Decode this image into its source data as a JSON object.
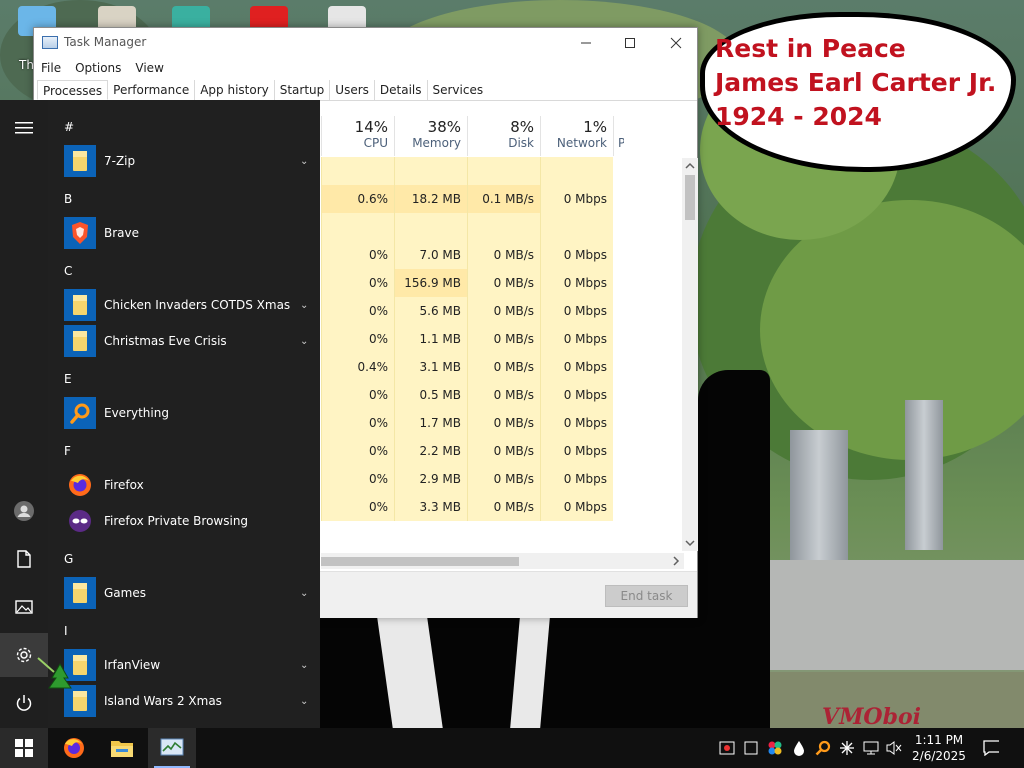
{
  "desktop": {
    "speech_lines": [
      "Rest in Peace",
      "James Earl Carter Jr.",
      "1924 - 2024"
    ],
    "watermark": "VMOboi",
    "recycle_label_fragment": "Th"
  },
  "task_manager": {
    "title": "Task Manager",
    "menu": [
      "File",
      "Options",
      "View"
    ],
    "tabs": [
      "Processes",
      "Performance",
      "App history",
      "Startup",
      "Users",
      "Details",
      "Services"
    ],
    "active_tab": "Processes",
    "columns": [
      {
        "percent": "14%",
        "label": "CPU"
      },
      {
        "percent": "38%",
        "label": "Memory"
      },
      {
        "percent": "8%",
        "label": "Disk"
      },
      {
        "percent": "1%",
        "label": "Network"
      },
      {
        "percent": "",
        "label": "P"
      }
    ],
    "rows": [
      {
        "cpu": "",
        "memory": "",
        "disk": "",
        "network": ""
      },
      {
        "cpu": "0.6%",
        "memory": "18.2 MB",
        "disk": "0.1 MB/s",
        "network": "0 Mbps"
      },
      {
        "cpu": "",
        "memory": "",
        "disk": "",
        "network": ""
      },
      {
        "cpu": "0%",
        "memory": "7.0 MB",
        "disk": "0 MB/s",
        "network": "0 Mbps"
      },
      {
        "cpu": "0%",
        "memory": "156.9 MB",
        "disk": "0 MB/s",
        "network": "0 Mbps"
      },
      {
        "cpu": "0%",
        "memory": "5.6 MB",
        "disk": "0 MB/s",
        "network": "0 Mbps"
      },
      {
        "cpu": "0%",
        "memory": "1.1 MB",
        "disk": "0 MB/s",
        "network": "0 Mbps"
      },
      {
        "cpu": "0.4%",
        "memory": "3.1 MB",
        "disk": "0 MB/s",
        "network": "0 Mbps"
      },
      {
        "cpu": "0%",
        "memory": "0.5 MB",
        "disk": "0 MB/s",
        "network": "0 Mbps"
      },
      {
        "cpu": "0%",
        "memory": "1.7 MB",
        "disk": "0 MB/s",
        "network": "0 Mbps"
      },
      {
        "cpu": "0%",
        "memory": "2.2 MB",
        "disk": "0 MB/s",
        "network": "0 Mbps"
      },
      {
        "cpu": "0%",
        "memory": "2.9 MB",
        "disk": "0 MB/s",
        "network": "0 Mbps"
      },
      {
        "cpu": "0%",
        "memory": "3.3 MB",
        "disk": "0 MB/s",
        "network": "0 Mbps"
      }
    ],
    "end_task_label": "End task"
  },
  "start_menu": {
    "groups": [
      {
        "letter": "#",
        "apps": [
          {
            "name": "7-Zip",
            "icon": "folder",
            "expandable": true
          }
        ]
      },
      {
        "letter": "B",
        "apps": [
          {
            "name": "Brave",
            "icon": "brave",
            "expandable": false
          }
        ]
      },
      {
        "letter": "C",
        "apps": [
          {
            "name": "Chicken Invaders COTDS Xmas",
            "icon": "folder",
            "expandable": true
          },
          {
            "name": "Christmas Eve Crisis",
            "icon": "folder",
            "expandable": true
          }
        ]
      },
      {
        "letter": "E",
        "apps": [
          {
            "name": "Everything",
            "icon": "everything",
            "expandable": false
          }
        ]
      },
      {
        "letter": "F",
        "apps": [
          {
            "name": "Firefox",
            "icon": "firefox",
            "expandable": false
          },
          {
            "name": "Firefox Private Browsing",
            "icon": "firefox-private",
            "expandable": false
          }
        ]
      },
      {
        "letter": "G",
        "apps": [
          {
            "name": "Games",
            "icon": "folder",
            "expandable": true
          }
        ]
      },
      {
        "letter": "I",
        "apps": [
          {
            "name": "IrfanView",
            "icon": "folder",
            "expandable": true
          },
          {
            "name": "Island Wars 2 Xmas",
            "icon": "folder",
            "expandable": true
          }
        ]
      }
    ]
  },
  "taskbar": {
    "clock_time": "1:11 PM",
    "clock_date": "2/6/2025"
  },
  "colors": {
    "accent": "#0b63b8",
    "heat_light": "#fff4c4",
    "heat_mid": "#ffe9a8",
    "speech_text": "#c1121f"
  }
}
